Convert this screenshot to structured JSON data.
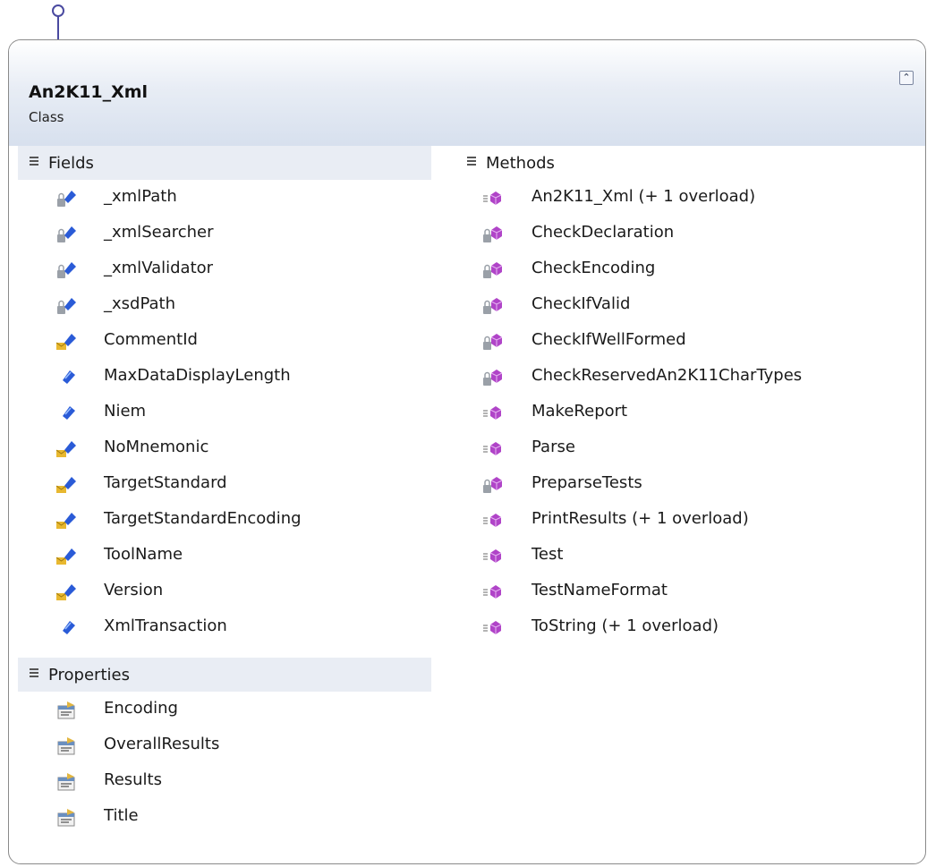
{
  "class": {
    "name": "An2K11_Xml",
    "kind": "Class"
  },
  "compartments": {
    "fields": {
      "title": "Fields",
      "items": [
        {
          "label": "_xmlPath",
          "icon": "private-field-icon"
        },
        {
          "label": "_xmlSearcher",
          "icon": "private-field-icon"
        },
        {
          "label": "_xmlValidator",
          "icon": "private-field-icon"
        },
        {
          "label": "_xsdPath",
          "icon": "private-field-icon"
        },
        {
          "label": "CommentId",
          "icon": "internal-field-icon"
        },
        {
          "label": "MaxDataDisplayLength",
          "icon": "public-field-icon"
        },
        {
          "label": "Niem",
          "icon": "public-field-icon"
        },
        {
          "label": "NoMnemonic",
          "icon": "internal-field-icon"
        },
        {
          "label": "TargetStandard",
          "icon": "internal-field-icon"
        },
        {
          "label": "TargetStandardEncoding",
          "icon": "internal-field-icon"
        },
        {
          "label": "ToolName",
          "icon": "internal-field-icon"
        },
        {
          "label": "Version",
          "icon": "internal-field-icon"
        },
        {
          "label": "XmlTransaction",
          "icon": "public-field-icon"
        }
      ]
    },
    "properties": {
      "title": "Properties",
      "items": [
        {
          "label": "Encoding",
          "icon": "property-icon"
        },
        {
          "label": "OverallResults",
          "icon": "property-icon"
        },
        {
          "label": "Results",
          "icon": "property-icon"
        },
        {
          "label": "Title",
          "icon": "property-icon"
        }
      ]
    },
    "methods": {
      "title": "Methods",
      "items": [
        {
          "label": "An2K11_Xml (+ 1 overload)",
          "icon": "public-method-icon"
        },
        {
          "label": "CheckDeclaration",
          "icon": "private-method-icon"
        },
        {
          "label": "CheckEncoding",
          "icon": "private-method-icon"
        },
        {
          "label": "CheckIfValid",
          "icon": "private-method-icon"
        },
        {
          "label": "CheckIfWellFormed",
          "icon": "private-method-icon"
        },
        {
          "label": "CheckReservedAn2K11CharTypes",
          "icon": "private-method-icon"
        },
        {
          "label": "MakeReport",
          "icon": "public-method-icon"
        },
        {
          "label": "Parse",
          "icon": "public-method-icon"
        },
        {
          "label": "PreparseTests",
          "icon": "private-method-icon"
        },
        {
          "label": "PrintResults (+ 1 overload)",
          "icon": "public-method-icon"
        },
        {
          "label": "Test",
          "icon": "public-method-icon"
        },
        {
          "label": "TestNameFormat",
          "icon": "public-method-icon"
        },
        {
          "label": "ToString (+ 1 overload)",
          "icon": "public-method-icon"
        }
      ]
    }
  },
  "colors": {
    "field_blue": "#2a5bd7",
    "method_purple": "#b044c8",
    "lock_gray": "#9aa0a8",
    "envelope_yellow": "#e8b830",
    "header_gradient_end": "#d7e0ee"
  }
}
